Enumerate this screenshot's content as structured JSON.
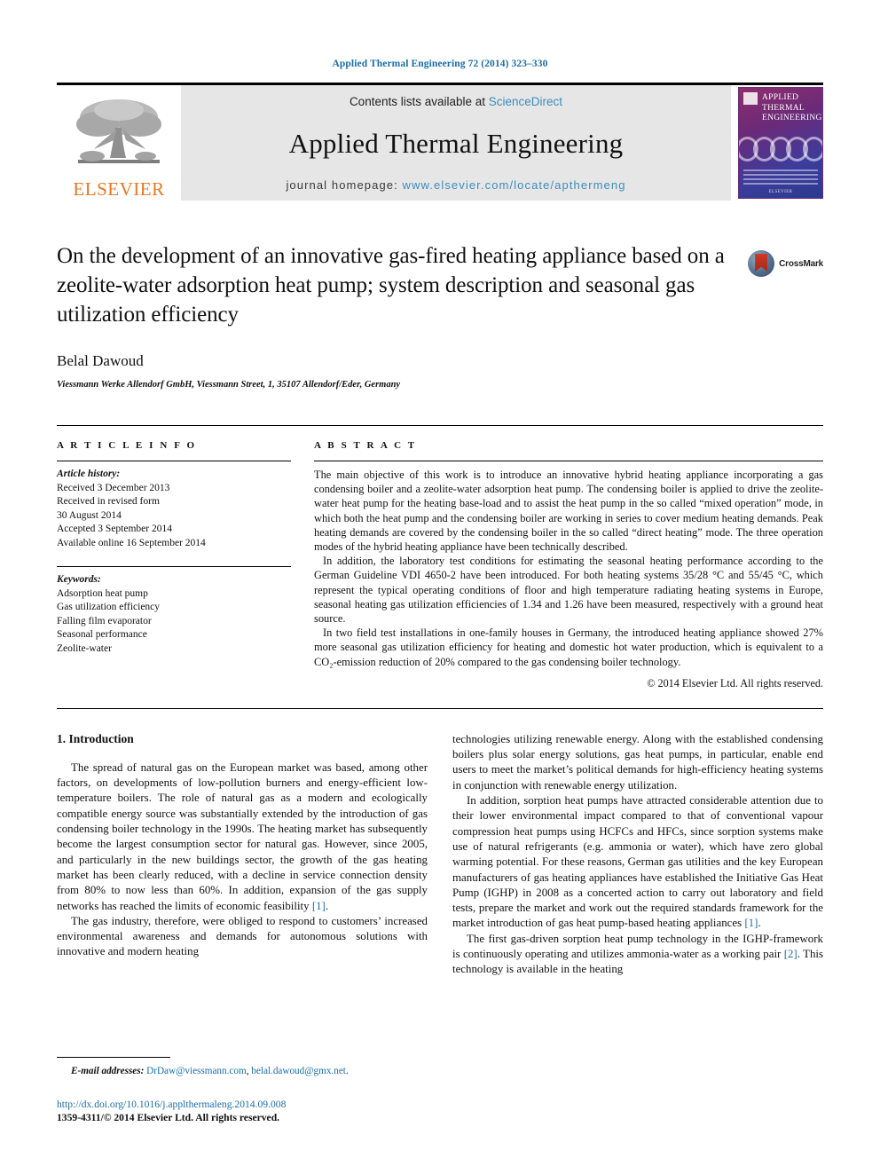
{
  "running_head": "Applied Thermal Engineering 72 (2014) 323–330",
  "masthead": {
    "publisher_name": "ELSEVIER",
    "contents_prefix": "Contents lists available at ",
    "contents_link": "ScienceDirect",
    "journal_title": "Applied Thermal Engineering",
    "homepage_prefix": "journal homepage: ",
    "homepage_url": "www.elsevier.com/locate/apthermeng",
    "cover": {
      "line1": "APPLIED",
      "line2": "THERMAL",
      "line3": "ENGINEERING",
      "footer": "ELSEVIER"
    }
  },
  "article": {
    "title": "On the development of an innovative gas-fired heating appliance based on a zeolite-water adsorption heat pump; system description and seasonal gas utilization efficiency",
    "author": "Belal Dawoud",
    "affiliation": "Viessmann Werke Allendorf GmbH, Viessmann Street, 1, 35107 Allendorf/Eder, Germany",
    "crossmark_label": "CrossMark"
  },
  "article_info": {
    "heading": "A R T I C L E   I N F O",
    "history_label": "Article history:",
    "history": [
      "Received 3 December 2013",
      "Received in revised form",
      "30 August 2014",
      "Accepted 3 September 2014",
      "Available online 16 September 2014"
    ],
    "keywords_label": "Keywords:",
    "keywords": [
      "Adsorption heat pump",
      "Gas utilization efficiency",
      "Falling film evaporator",
      "Seasonal performance",
      "Zeolite-water"
    ]
  },
  "abstract": {
    "heading": "A B S T R A C T",
    "paragraphs": [
      "The main objective of this work is to introduce an innovative hybrid heating appliance incorporating a gas condensing boiler and a zeolite-water adsorption heat pump. The condensing boiler is applied to drive the zeolite-water heat pump for the heating base-load and to assist the heat pump in the so called “mixed operation” mode, in which both the heat pump and the condensing boiler are working in series to cover medium heating demands. Peak heating demands are covered by the condensing boiler in the so called “direct heating” mode. The three operation modes of the hybrid heating appliance have been technically described.",
      "In addition, the laboratory test conditions for estimating the seasonal heating performance according to the German Guideline VDI 4650-2 have been introduced. For both heating systems 35/28 °C and 55/45 °C, which represent the typical operating conditions of floor and high temperature radiating heating systems in Europe, seasonal heating gas utilization efficiencies of 1.34 and 1.26 have been measured, respectively with a ground heat source.",
      "In two field test installations in one-family houses in Germany, the introduced heating appliance showed 27% more seasonal gas utilization efficiency for heating and domestic hot water production, which is equivalent to a CO₂-emission reduction of 20% compared to the gas condensing boiler technology."
    ],
    "copyright": "© 2014 Elsevier Ltd. All rights reserved."
  },
  "body": {
    "section_number_title": "1.  Introduction",
    "left_paragraphs": [
      "The spread of natural gas on the European market was based, among other factors, on developments of low-pollution burners and energy-efficient low-temperature boilers. The role of natural gas as a modern and ecologically compatible energy source was substantially extended by the introduction of gas condensing boiler technology in the 1990s. The heating market has subsequently become the largest consumption sector for natural gas. However, since 2005, and particularly in the new buildings sector, the growth of the gas heating market has been clearly reduced, with a decline in service connection density from 80% to now less than 60%. In addition, expansion of the gas supply networks has reached the limits of economic feasibility [1].",
      "The gas industry, therefore, were obliged to respond to customers’ increased environmental awareness and demands for autonomous solutions with innovative and modern heating"
    ],
    "right_paragraphs": [
      "technologies utilizing renewable energy. Along with the established condensing boilers plus solar energy solutions, gas heat pumps, in particular, enable end users to meet the market’s political demands for high-efficiency heating systems in conjunction with renewable energy utilization.",
      "In addition, sorption heat pumps have attracted considerable attention due to their lower environmental impact compared to that of conventional vapour compression heat pumps using HCFCs and HFCs, since sorption systems make use of natural refrigerants (e.g. ammonia or water), which have zero global warming potential. For these reasons, German gas utilities and the key European manufacturers of gas heating appliances have established the Initiative Gas Heat Pump (IGHP) in 2008 as a concerted action to carry out laboratory and field tests, prepare the market and work out the required standards framework for the market introduction of gas heat pump-based heating appliances [1].",
      "The first gas-driven sorption heat pump technology in the IGHP-framework is continuously operating and utilizes ammonia-water as a working pair [2]. This technology is available in the heating"
    ]
  },
  "footnote": {
    "email_label": "E-mail addresses:",
    "email_1": "DrDaw@viessmann.com",
    "email_sep": ", ",
    "email_2": "belal.dawoud@gmx.net",
    "email_end": ".",
    "doi": "http://dx.doi.org/10.1016/j.applthermaleng.2014.09.008",
    "issn": "1359-4311/© 2014 Elsevier Ltd. All rights reserved."
  },
  "colors": {
    "link": "#1a6ea8",
    "elsevier_orange": "#E87722",
    "masthead_bg": "#e6e6e6"
  }
}
